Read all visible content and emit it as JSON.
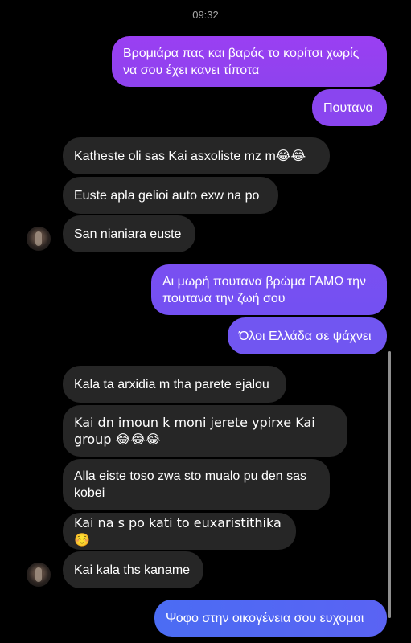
{
  "status": {
    "time": "09:32"
  },
  "messages": [
    {
      "from": "me",
      "text": "Βρομιάρα πας και βαράς το κορίτσι χωρίς να σου έχει κανει τίποτα"
    },
    {
      "from": "me",
      "text": "Πουτανα"
    },
    {
      "from": "them",
      "text": "Katheste oli sas Kai asxoliste mz m😂😂"
    },
    {
      "from": "them",
      "text": "Euste apla gelioi auto exw na po"
    },
    {
      "from": "them",
      "text": "San nianiara euste"
    },
    {
      "from": "me",
      "text": "Αι μωρή πουτανα βρώμα ΓΑΜΩ την πουτανα την ζωή σου"
    },
    {
      "from": "me",
      "text": "Όλοι Ελλάδα σε ψάχνει"
    },
    {
      "from": "them",
      "text": "Kala ta arxidia m tha parete ejalou"
    },
    {
      "from": "them",
      "text": "Kai dn imoun k moni jerete ypirxe Kai group 😂😂😂"
    },
    {
      "from": "them",
      "text": "Alla eiste toso zwa sto mualo pu den sas kobei"
    },
    {
      "from": "them",
      "text": "Kai na s po kati to euxaristithika ☺️"
    },
    {
      "from": "them",
      "text": "Kai kala ths kaname"
    },
    {
      "from": "me",
      "text": "Ψοφο στην οικογένεια σου ευχομαι"
    }
  ],
  "colors": {
    "background": "#000000",
    "incoming_bubble": "#262626",
    "outgoing_gradient_top": "#9a3ff2",
    "outgoing_gradient_bottom": "#4b6cf3"
  },
  "icons": {
    "avatar": "contact-avatar"
  }
}
